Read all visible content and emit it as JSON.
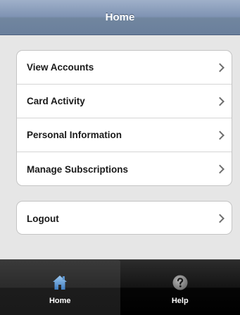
{
  "header": {
    "title": "Home"
  },
  "menu": {
    "items": [
      {
        "label": "View Accounts"
      },
      {
        "label": "Card Activity"
      },
      {
        "label": "Personal Information"
      },
      {
        "label": "Manage Subscriptions"
      }
    ]
  },
  "logout": {
    "label": "Logout"
  },
  "tabbar": {
    "tabs": [
      {
        "label": "Home",
        "icon": "home-icon",
        "active": true
      },
      {
        "label": "Help",
        "icon": "help-icon",
        "active": false
      }
    ]
  },
  "colors": {
    "header": "#7f93b3",
    "tabbar": "#000000",
    "home_icon": "#6fa3d6"
  }
}
